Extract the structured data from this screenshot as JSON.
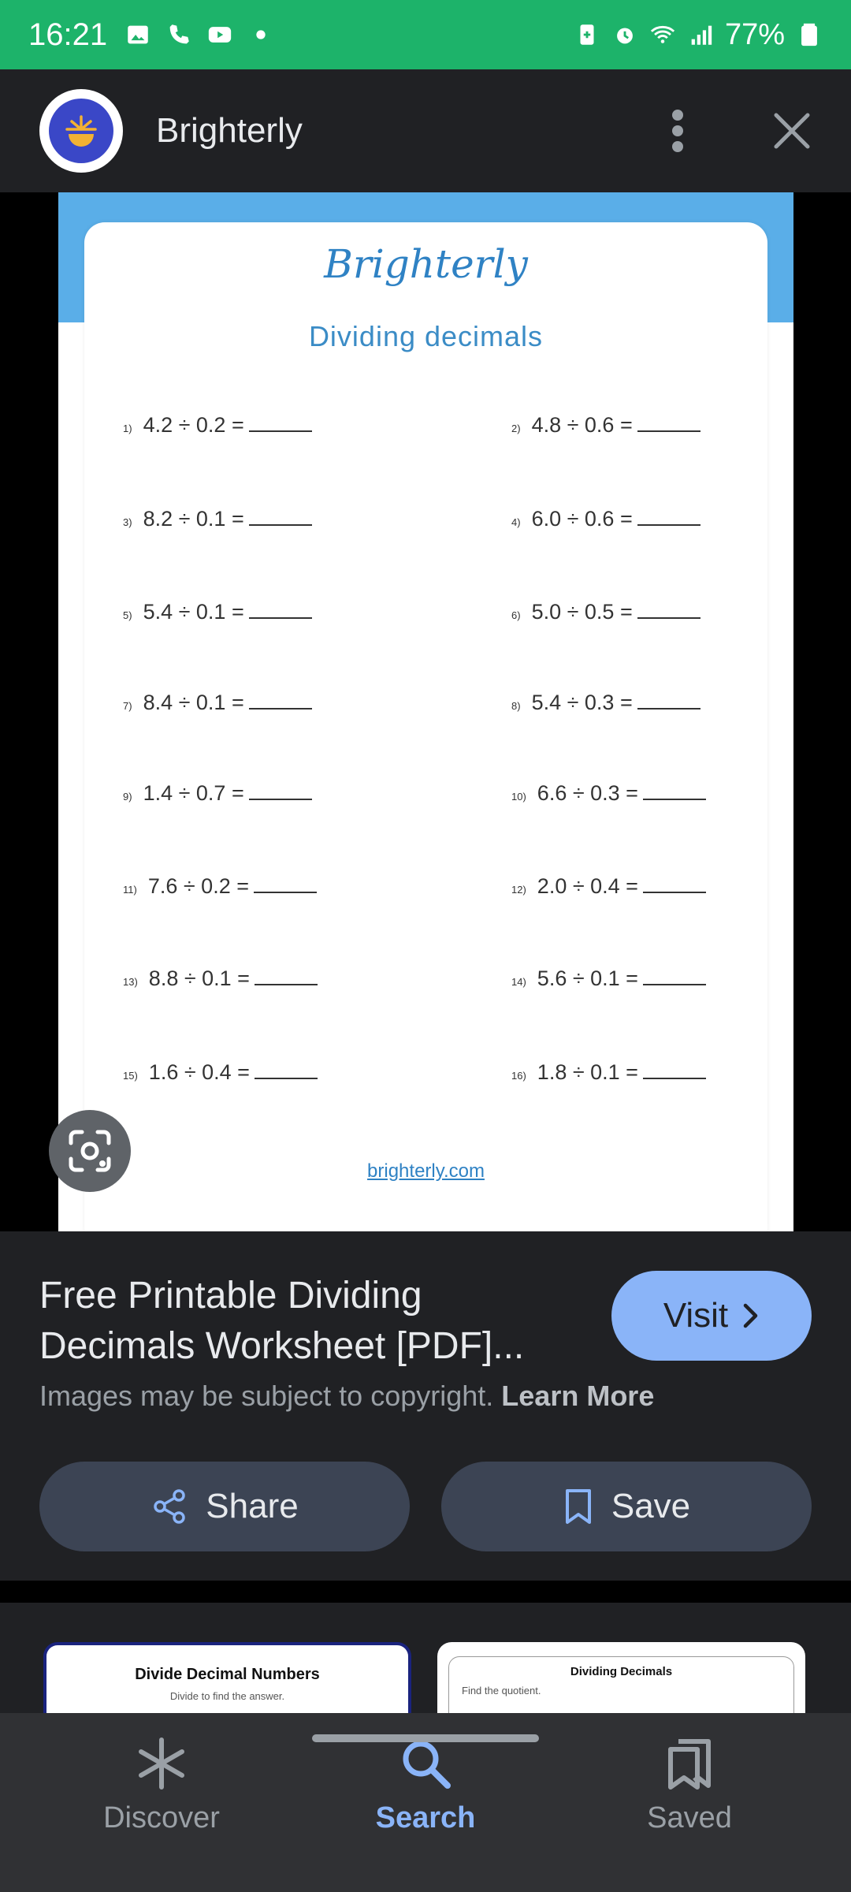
{
  "status_bar": {
    "time": "16:21",
    "battery": "77%"
  },
  "header": {
    "site_name": "Brighterly"
  },
  "worksheet": {
    "brand": "Brighterly",
    "title": "Dividing decimals",
    "footer": "brighterly.com",
    "problems_left": [
      {
        "num": "1)",
        "text": "4.2 ÷ 0.2 ="
      },
      {
        "num": "3)",
        "text": "8.2 ÷ 0.1 ="
      },
      {
        "num": "5)",
        "text": "5.4 ÷ 0.1 ="
      },
      {
        "num": "7)",
        "text": "8.4 ÷ 0.1 ="
      },
      {
        "num": "9)",
        "text": "1.4 ÷ 0.7 ="
      },
      {
        "num": "11)",
        "text": "7.6 ÷ 0.2 ="
      },
      {
        "num": "13)",
        "text": "8.8 ÷ 0.1 ="
      },
      {
        "num": "15)",
        "text": "1.6 ÷ 0.4 ="
      }
    ],
    "problems_right": [
      {
        "num": "2)",
        "text": "4.8 ÷ 0.6 ="
      },
      {
        "num": "4)",
        "text": "6.0 ÷ 0.6 ="
      },
      {
        "num": "6)",
        "text": "5.0 ÷ 0.5 ="
      },
      {
        "num": "8)",
        "text": "5.4 ÷ 0.3 ="
      },
      {
        "num": "10)",
        "text": "6.6 ÷ 0.3 ="
      },
      {
        "num": "12)",
        "text": "2.0 ÷ 0.4 ="
      },
      {
        "num": "14)",
        "text": "5.6 ÷ 0.1 ="
      },
      {
        "num": "16)",
        "text": "1.8 ÷ 0.1 ="
      }
    ]
  },
  "info": {
    "title": "Free Printable Dividing Decimals Worksheet [PDF]...",
    "visit_label": "Visit",
    "copyright_text": "Images may be subject to copyright.",
    "learn_more": "Learn More",
    "share_label": "Share",
    "save_label": "Save"
  },
  "related": {
    "thumb1_title": "Divide Decimal Numbers",
    "thumb1_sub": "Divide to find the answer.",
    "thumb2_title": "Dividing Decimals",
    "thumb2_sub": "Find the quotient."
  },
  "bottom_nav": [
    {
      "label": "Discover",
      "icon": "asterisk-icon"
    },
    {
      "label": "Search",
      "icon": "search-icon"
    },
    {
      "label": "Saved",
      "icon": "bookmarks-icon"
    }
  ],
  "colors": {
    "status_bar": "#1db36a",
    "accent": "#8ab4f8",
    "background": "#202124"
  }
}
